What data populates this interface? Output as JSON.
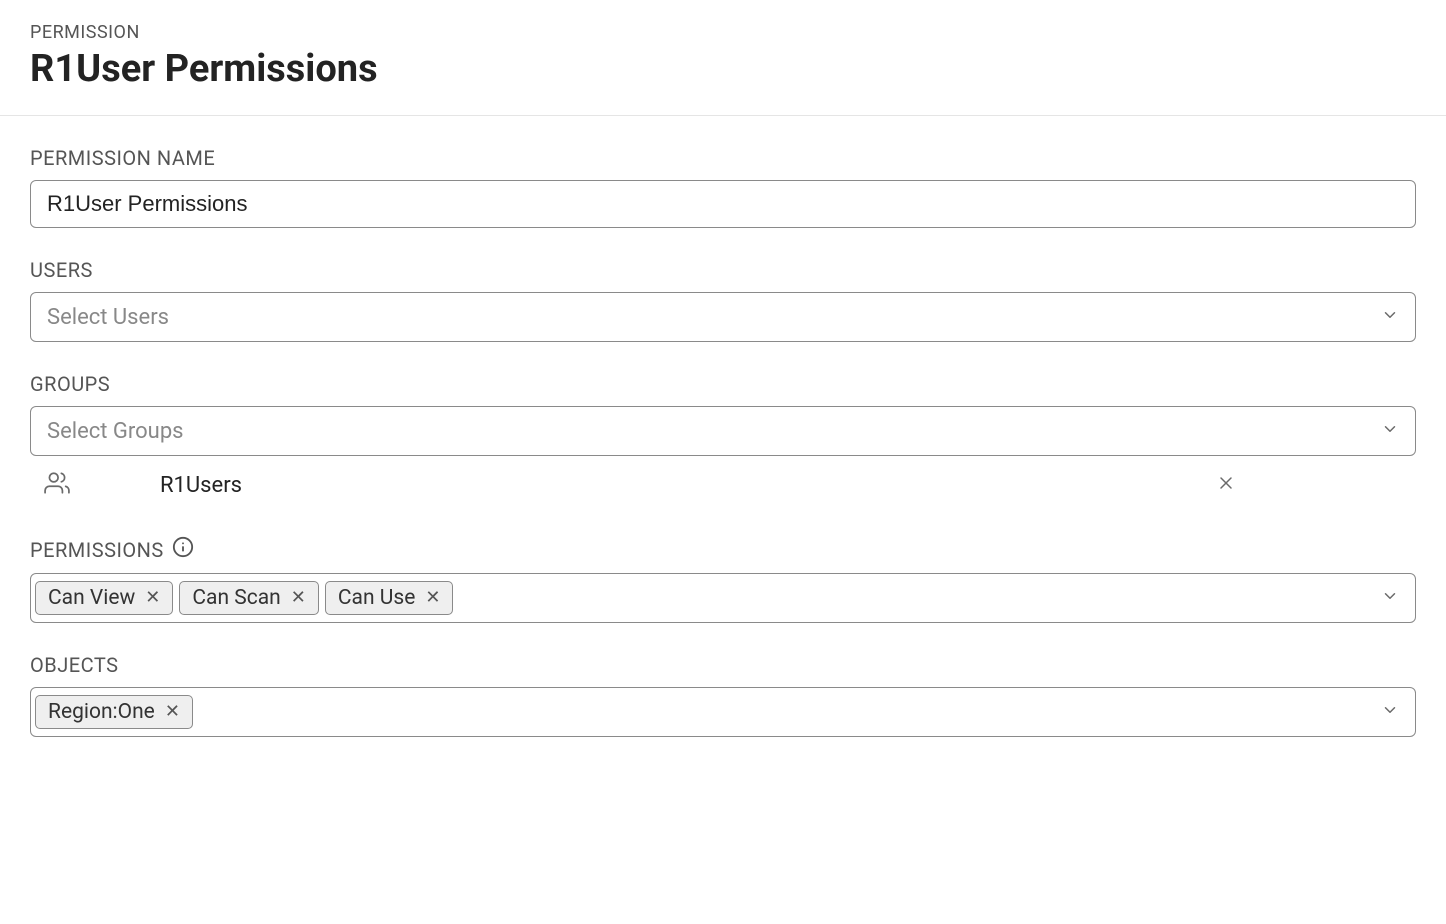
{
  "header": {
    "label": "PERMISSION",
    "title": "R1User Permissions"
  },
  "fields": {
    "permission_name": {
      "label": "PERMISSION NAME",
      "value": "R1User Permissions"
    },
    "users": {
      "label": "USERS",
      "placeholder": "Select Users"
    },
    "groups": {
      "label": "GROUPS",
      "placeholder": "Select Groups",
      "selected": [
        {
          "name": "R1Users"
        }
      ]
    },
    "permissions": {
      "label": "PERMISSIONS",
      "tags": [
        "Can View",
        "Can Scan",
        "Can Use"
      ]
    },
    "objects": {
      "label": "OBJECTS",
      "tags": [
        "Region:One"
      ]
    }
  }
}
